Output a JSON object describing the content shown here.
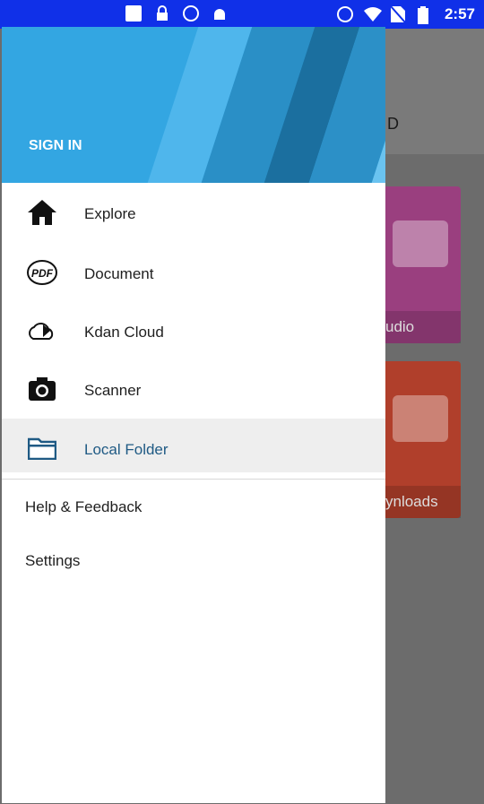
{
  "status_bar": {
    "time": "2:57",
    "icons_left": [
      "notification-icon",
      "lock-icon",
      "circle-icon",
      "android-icon"
    ],
    "icons_right": [
      "alarm-icon",
      "wifi-icon",
      "no-sim-icon",
      "battery-icon"
    ]
  },
  "background_app": {
    "header_text": "D",
    "cards": [
      {
        "label": "udio",
        "color": "#9a3f7f"
      },
      {
        "label": "ynloads",
        "color": "#b03f2b"
      }
    ]
  },
  "drawer": {
    "header": {
      "sign_in_label": "SIGN IN"
    },
    "nav_items": [
      {
        "label": "Explore",
        "icon": "home-icon"
      },
      {
        "label": "Document",
        "icon": "pdf-icon"
      },
      {
        "label": "Kdan Cloud",
        "icon": "cloud-sync-icon"
      },
      {
        "label": "Scanner",
        "icon": "camera-icon"
      },
      {
        "label": "Local Folder",
        "icon": "folder-icon",
        "selected": true
      }
    ],
    "secondary_items": [
      {
        "label": "Help & Feedback"
      },
      {
        "label": "Settings"
      }
    ]
  },
  "colors": {
    "header_blue": "#33a6e2",
    "accent_text": "#1f5a84",
    "status_bar": "#1030e8"
  }
}
